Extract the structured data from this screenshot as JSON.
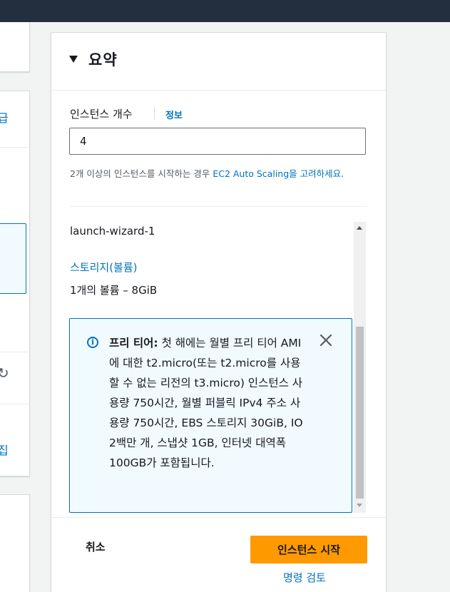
{
  "left_panel": {
    "tab_fragment": "급",
    "edit_fragment": "집",
    "refresh_icon": "refresh-icon"
  },
  "summary": {
    "title": "요약",
    "instance_count_label": "인스턴스 개수",
    "info_link": "정보",
    "instance_count_value": "4",
    "hint_prefix": "2개 이상의 인스턴스를 시작하는 경우 ",
    "hint_link": "EC2 Auto Scaling을 고려하세요.",
    "security_group": "launch-wizard-1",
    "storage_link": "스토리지(볼륨)",
    "storage_value": "1개의 볼륨 – 8GiB",
    "alert": {
      "title": "프리 티어:",
      "body": " 첫 해에는 월별 프리 티어 AMI에 대한 t2.micro(또는 t2.micro를 사용할 수 없는 리전의 t3.micro) 인스턴스 사용량 750시간, 월별 퍼블릭 IPv4 주소 사용량 750시간, EBS 스토리지 30GiB, IO 2백만 개, 스냅샷 1GB, 인터넷 대역폭 100GB가 포함됩니다.",
      "icon": "info-icon"
    }
  },
  "footer": {
    "cancel": "취소",
    "launch": "인스턴스 시작",
    "review": "명령 검토"
  },
  "colors": {
    "topbar": "#232f3e",
    "link": "#0073bb",
    "primary_button": "#ff9900",
    "alert_bg": "#f1faff"
  }
}
